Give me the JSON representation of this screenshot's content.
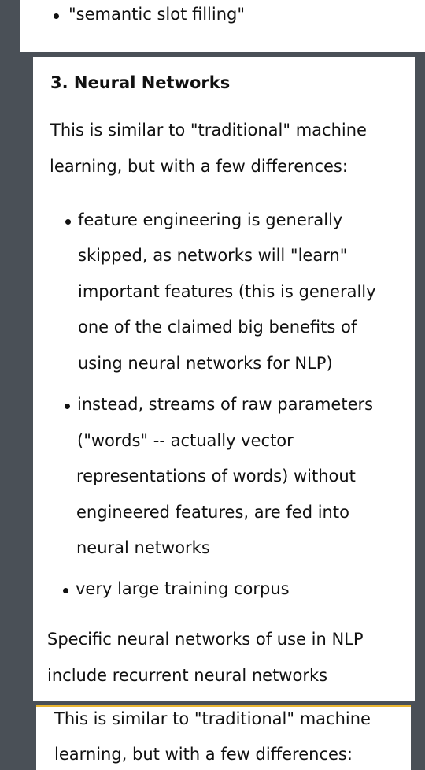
{
  "prev_card": {
    "bullet": "\"semantic slot filling\""
  },
  "section": {
    "heading": "3. Neural Networks",
    "intro_lines": [
      "This is similar to \"traditional\" machine",
      "learning, but with a few differences:"
    ],
    "bullets": [
      {
        "lines": [
          "feature engineering is generally",
          "skipped, as networks will \"learn\"",
          "important features (this is generally",
          "one of the claimed big benefits of",
          "using neural networks for NLP)"
        ]
      },
      {
        "lines": [
          "instead, streams of raw parameters",
          "(\"words\" -- actually vector",
          "representations of words) without",
          "engineered features, are fed into",
          "neural networks"
        ]
      },
      {
        "lines": [
          "very large training corpus"
        ]
      }
    ],
    "outro_lines": [
      "Specific neural networks of use in NLP",
      "include recurrent neural networks"
    ]
  },
  "next_card": {
    "lines": [
      "This is similar to \"traditional\" machine",
      "learning, but with a few differences:"
    ]
  }
}
